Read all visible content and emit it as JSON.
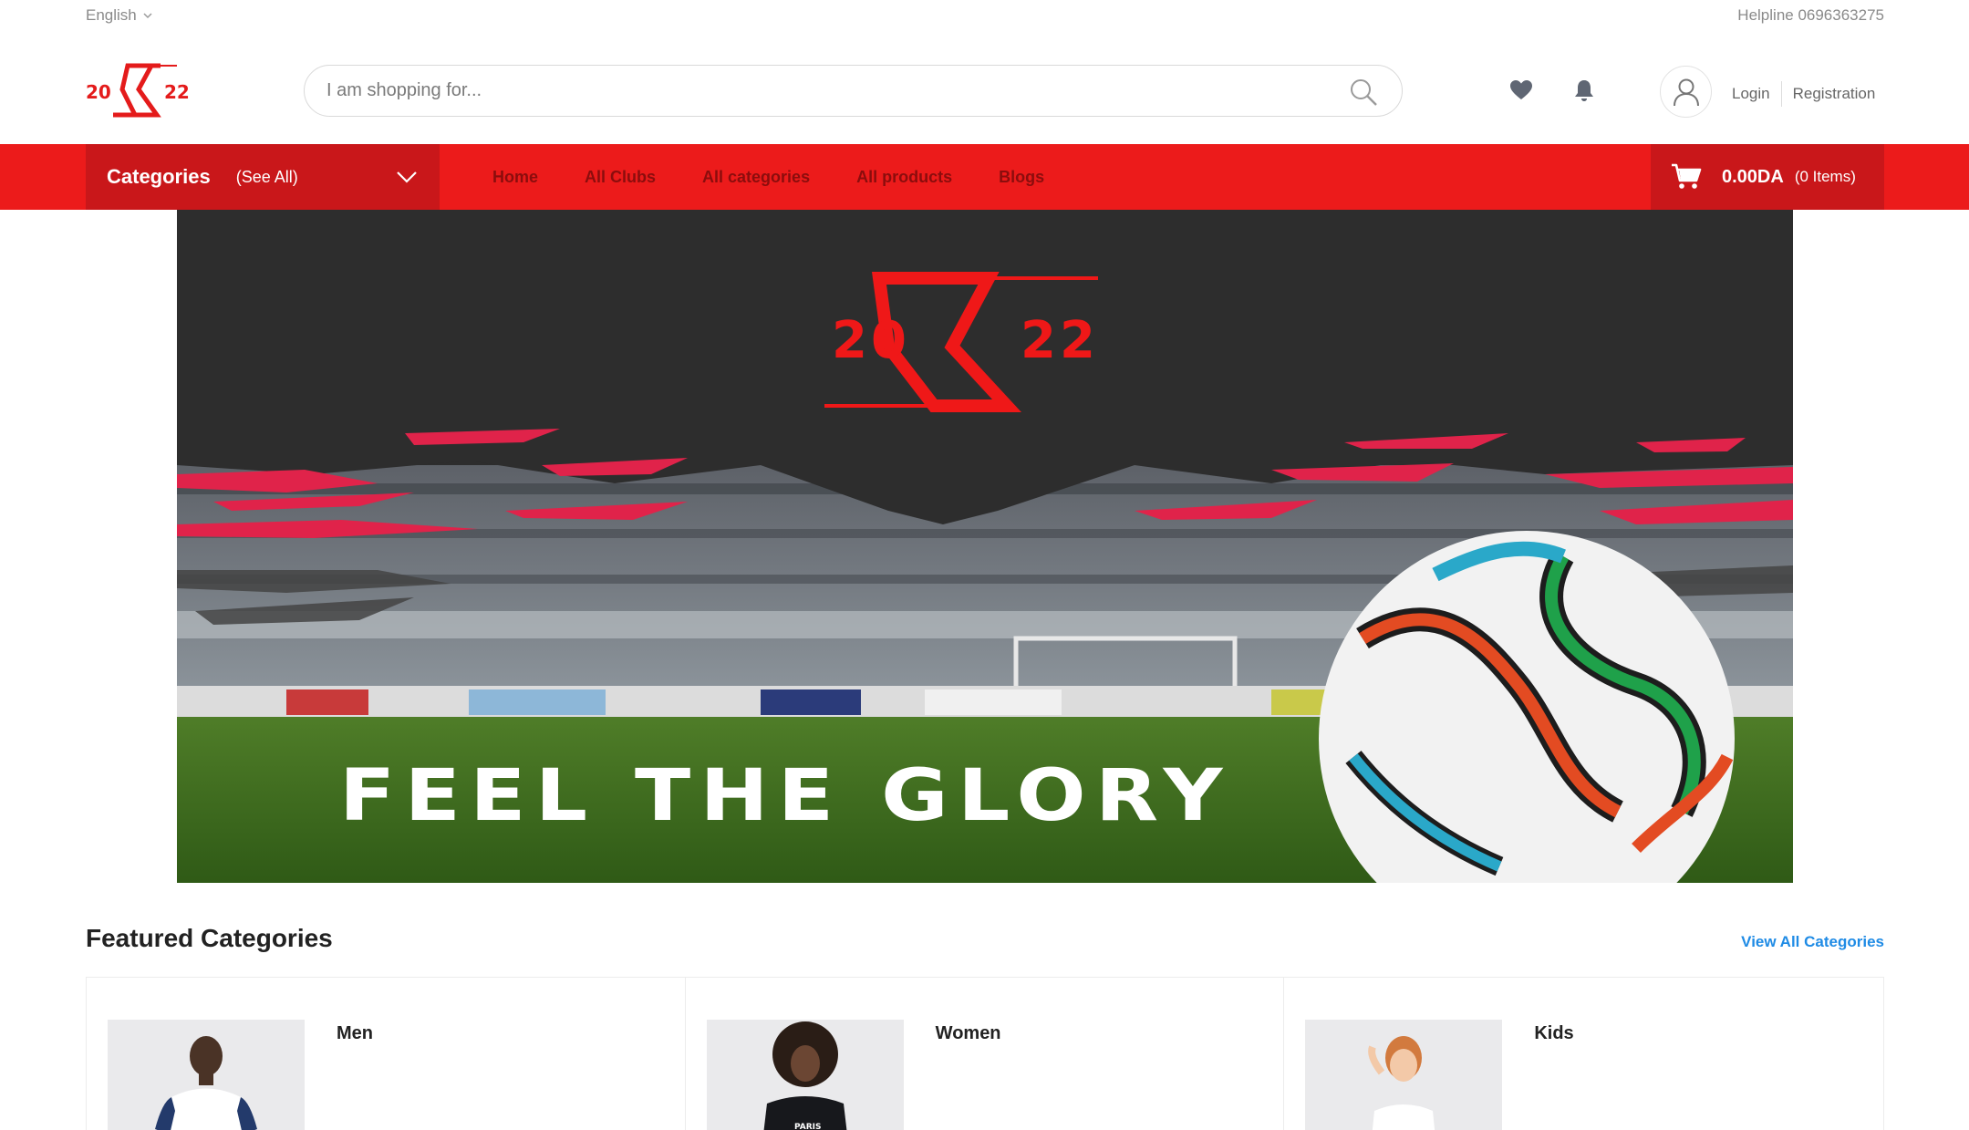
{
  "topbar": {
    "language": "English",
    "helpline": "Helpline 0696363275"
  },
  "header": {
    "logo_text": "20X22",
    "search_placeholder": "I am shopping for...",
    "login_label": "Login",
    "registration_label": "Registration",
    "icons": [
      "heart-icon",
      "bell-icon",
      "user-icon",
      "search-icon"
    ]
  },
  "nav": {
    "categories_label": "Categories",
    "see_all_label": "(See All)",
    "menu": [
      "Home",
      "All Clubs",
      "All categories",
      "All products",
      "Blogs"
    ],
    "cart_total": "0.00DA",
    "cart_items": "(0 Items)"
  },
  "hero": {
    "logo_text": "20X22",
    "headline": "FEEL THE GLORY"
  },
  "featured": {
    "title": "Featured Categories",
    "view_all": "View All Categories",
    "categories": [
      "Men",
      "Women",
      "Kids"
    ]
  },
  "colors": {
    "brand_red": "#ec1b1b",
    "brand_dark_red": "#c9171a",
    "link_blue": "#1f8be5"
  }
}
